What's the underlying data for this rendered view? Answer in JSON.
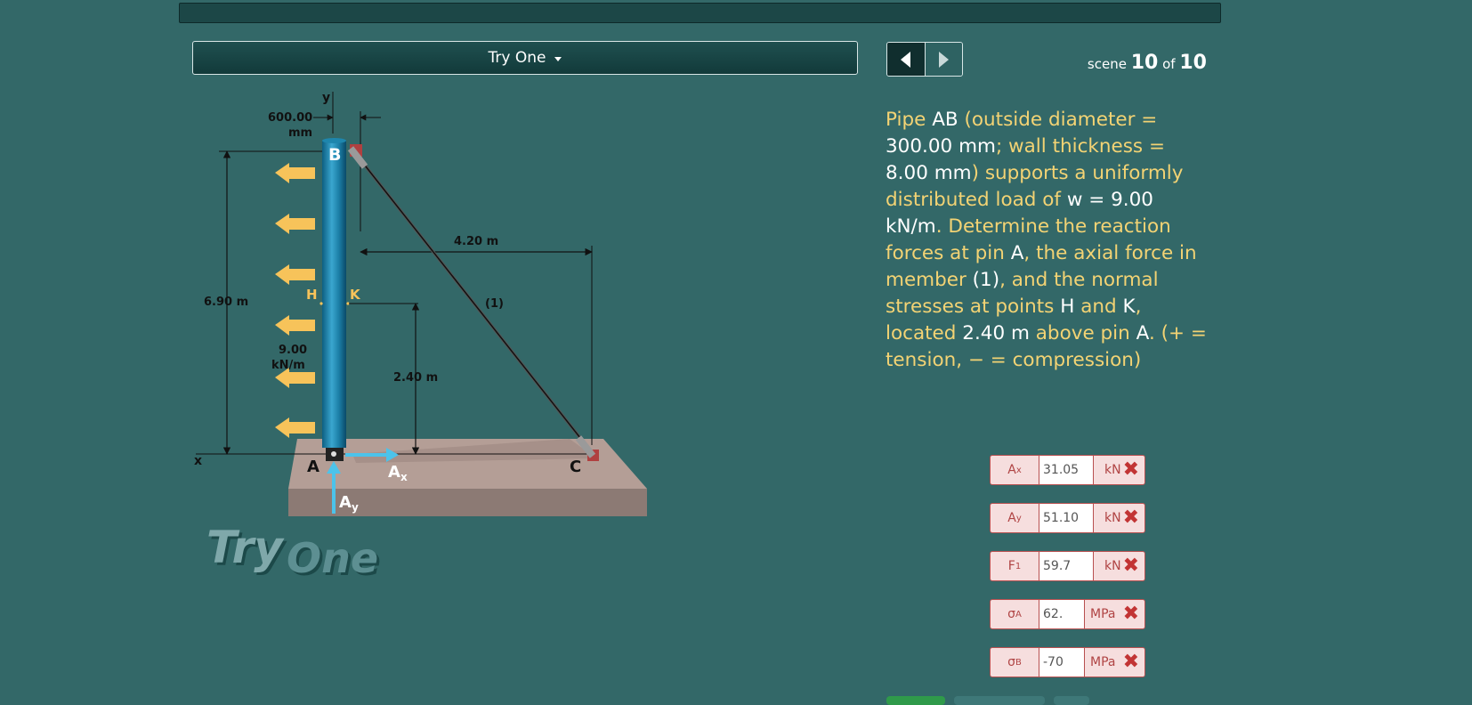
{
  "selector": {
    "label": "Try One"
  },
  "nav": {
    "prev_icon": "arrow-left-icon",
    "next_icon": "arrow-right-icon"
  },
  "scene": {
    "prefix": "scene",
    "current": "10",
    "of": "of",
    "total": "10"
  },
  "problem": {
    "t1": "Pipe ",
    "v1": "AB",
    "t2": " (outside diameter = ",
    "v2": "300.00 mm",
    "t3": "; wall thickness = ",
    "v3": "8.00 mm",
    "t4": ") supports a uniformly distributed load of ",
    "v4": "w = 9.00 kN/m",
    "t5": ". Determine the reaction forces at pin ",
    "v5": "A",
    "t6": ", the axial force in member ",
    "v6": "(1)",
    "t7": ", and the normal stresses at points ",
    "v7": "H",
    "t8": " and ",
    "v8": "K",
    "t9": ", located ",
    "v9": "2.40 m",
    "t10": " above pin ",
    "v10": "A",
    "t11": ". (+ = tension, − = compression)"
  },
  "figure": {
    "dim_width": "600.00",
    "dim_width_unit": "mm",
    "dim_height": "6.90 m",
    "dim_horizontal": "4.20 m",
    "dim_hk": "2.40 m",
    "load_value": "9.00",
    "load_unit": "kN/m",
    "label_B": "B",
    "label_A": "A",
    "label_C": "C",
    "label_H": "H",
    "label_K": "K",
    "member_label": "(1)",
    "axis_x": "x",
    "axis_y": "y",
    "force_Ax": "A",
    "force_Ax_sub": "x",
    "force_Ay": "A",
    "force_Ay_sub": "y",
    "watermark_try": "Try",
    "watermark_one": "One"
  },
  "answers": [
    {
      "sym": "A",
      "sub": "x",
      "value": "31.05",
      "unit": "kN"
    },
    {
      "sym": "A",
      "sub": "y",
      "value": "51.10",
      "unit": "kN"
    },
    {
      "sym": "F",
      "sub": "1",
      "value": "59.7",
      "unit": "kN"
    },
    {
      "sym": "σ",
      "sub": "A",
      "value": "62.",
      "unit": "MPa"
    },
    {
      "sym": "σ",
      "sub": "B",
      "value": "-70",
      "unit": "MPa"
    }
  ],
  "status_icon": "x-mark-icon",
  "colors": {
    "background": "#336868",
    "prompt_text": "#f3d374",
    "load_arrow": "#f7c35a",
    "reaction_arrow": "#4cc3ea",
    "error": "#c23434"
  }
}
